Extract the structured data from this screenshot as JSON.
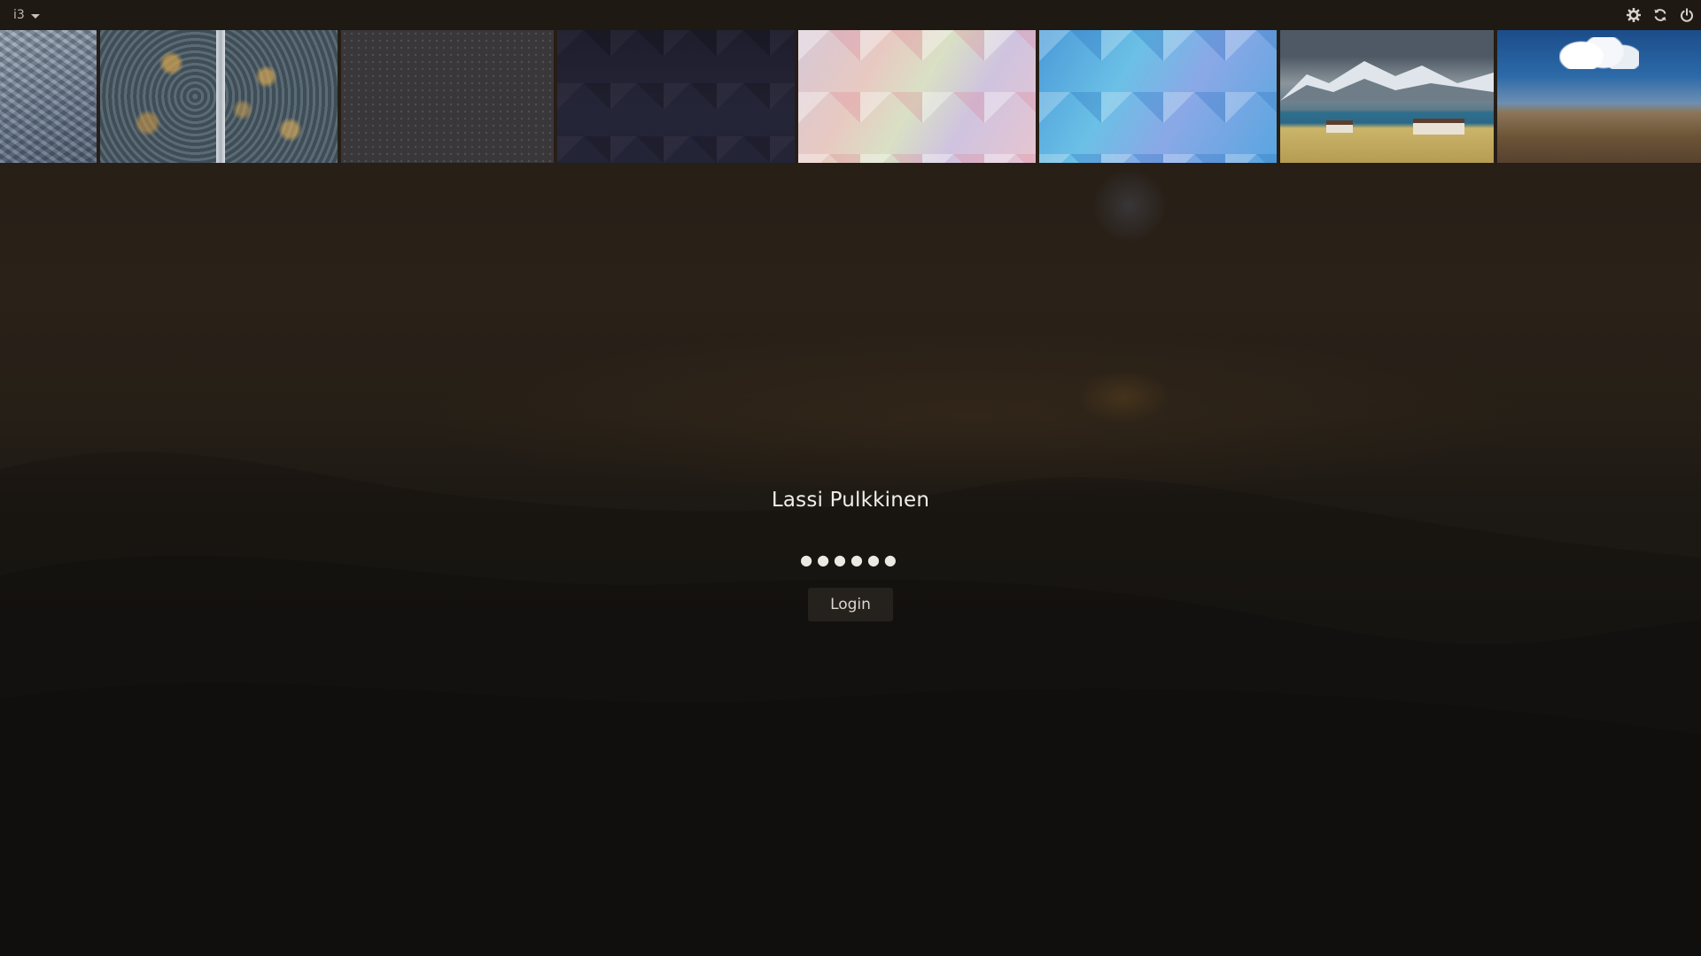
{
  "topbar": {
    "session_label": "i3",
    "icons": [
      "gear-icon",
      "refresh-icon",
      "power-icon"
    ]
  },
  "wallpapers": [
    {
      "name": "knit-texture"
    },
    {
      "name": "aerial-forest-road"
    },
    {
      "name": "dotted-gray-pattern"
    },
    {
      "name": "dark-triangle-pattern"
    },
    {
      "name": "pastel-triangle-pattern"
    },
    {
      "name": "blue-triangle-pattern"
    },
    {
      "name": "mountain-lake-houses"
    },
    {
      "name": "desert-sky-cloud"
    }
  ],
  "login": {
    "username": "Lassi Pulkkinen",
    "password_masked": "●●●●●●",
    "button_label": "Login"
  },
  "colors": {
    "background": "#1e1913",
    "text": "#f1ede8",
    "button": "#25211d"
  }
}
